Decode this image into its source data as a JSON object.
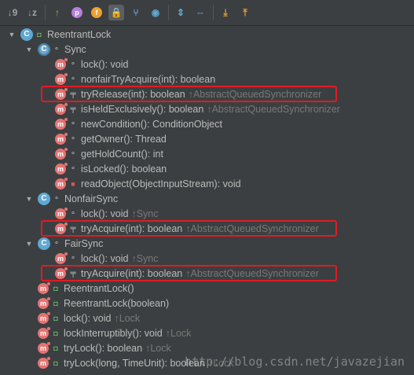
{
  "toolbar": {
    "buttons": [
      {
        "name": "sort-by-visibility-icon",
        "glyph": "↓",
        "sub": "9"
      },
      {
        "name": "sort-alphabetically-icon",
        "glyph": "↓",
        "sub": "z"
      },
      {
        "name": "show-inherited-icon",
        "glyph": "↑",
        "color": "#8bc34a"
      },
      {
        "name": "show-properties-icon",
        "glyph": "p",
        "color": "#b57edc"
      },
      {
        "name": "show-fields-icon",
        "glyph": "f",
        "color": "#f0a030"
      },
      {
        "name": "show-non-public-icon",
        "glyph": "🔒",
        "active": true,
        "color": "#e05252"
      },
      {
        "name": "show-lambdas-icon",
        "glyph": "⑂",
        "color": "#5fa8d3"
      },
      {
        "name": "show-anonymous-classes-icon",
        "glyph": "◉",
        "color": "#5fa8d3"
      },
      {
        "name": "expand-all-icon",
        "glyph": "⇕",
        "color": "#5fa8d3"
      },
      {
        "name": "collapse-all-icon",
        "glyph": "⇔",
        "color": "#5fa8d3"
      },
      {
        "name": "autoscroll-to-source-icon",
        "glyph": "⤓",
        "color": "#f0a030"
      },
      {
        "name": "autoscroll-from-source-icon",
        "glyph": "⤒",
        "color": "#f0a030"
      }
    ]
  },
  "tree": [
    {
      "indent": 0,
      "arrow": "▼",
      "kind": "class",
      "vis": "pub",
      "text": "ReentrantLock",
      "inh": ""
    },
    {
      "indent": 1,
      "arrow": "▼",
      "kind": "abs",
      "vis": "pkg",
      "text": "Sync",
      "inh": ""
    },
    {
      "indent": 2,
      "arrow": "",
      "kind": "m",
      "vis": "pkg",
      "text": "lock(): void",
      "inh": ""
    },
    {
      "indent": 2,
      "arrow": "",
      "kind": "m",
      "vis": "pkg",
      "text": "nonfairTryAcquire(int): boolean",
      "inh": ""
    },
    {
      "indent": 2,
      "arrow": "",
      "kind": "m",
      "vis": "prot",
      "text": "tryRelease(int): boolean",
      "inh": "↑AbstractQueuedSynchronizer",
      "hl": true
    },
    {
      "indent": 2,
      "arrow": "",
      "kind": "m",
      "vis": "prot",
      "text": "isHeldExclusively(): boolean",
      "inh": "↑AbstractQueuedSynchronizer"
    },
    {
      "indent": 2,
      "arrow": "",
      "kind": "m",
      "vis": "pkg",
      "text": "newCondition(): ConditionObject",
      "inh": ""
    },
    {
      "indent": 2,
      "arrow": "",
      "kind": "m",
      "vis": "pkg",
      "text": "getOwner(): Thread",
      "inh": ""
    },
    {
      "indent": 2,
      "arrow": "",
      "kind": "m",
      "vis": "pkg",
      "text": "getHoldCount(): int",
      "inh": ""
    },
    {
      "indent": 2,
      "arrow": "",
      "kind": "m",
      "vis": "pkg",
      "text": "isLocked(): boolean",
      "inh": ""
    },
    {
      "indent": 2,
      "arrow": "",
      "kind": "m",
      "vis": "priv",
      "text": "readObject(ObjectInputStream): void",
      "inh": ""
    },
    {
      "indent": 1,
      "arrow": "▼",
      "kind": "class",
      "vis": "pkg",
      "text": "NonfairSync",
      "inh": ""
    },
    {
      "indent": 2,
      "arrow": "",
      "kind": "m",
      "vis": "pkg",
      "text": "lock(): void",
      "inh": "↑Sync"
    },
    {
      "indent": 2,
      "arrow": "",
      "kind": "m",
      "vis": "prot",
      "text": "tryAcquire(int): boolean",
      "inh": "↑AbstractQueuedSynchronizer",
      "hl": true
    },
    {
      "indent": 1,
      "arrow": "▼",
      "kind": "class",
      "vis": "pkg",
      "text": "FairSync",
      "inh": ""
    },
    {
      "indent": 2,
      "arrow": "",
      "kind": "m",
      "vis": "pkg",
      "text": "lock(): void",
      "inh": "↑Sync"
    },
    {
      "indent": 2,
      "arrow": "",
      "kind": "m",
      "vis": "prot",
      "text": "tryAcquire(int): boolean",
      "inh": "↑AbstractQueuedSynchronizer",
      "hl": true
    },
    {
      "indent": 1,
      "arrow": "",
      "kind": "m",
      "vis": "pub",
      "text": "ReentrantLock()",
      "inh": ""
    },
    {
      "indent": 1,
      "arrow": "",
      "kind": "m",
      "vis": "pub",
      "text": "ReentrantLock(boolean)",
      "inh": ""
    },
    {
      "indent": 1,
      "arrow": "",
      "kind": "m",
      "vis": "pub",
      "text": "lock(): void",
      "inh": "↑Lock"
    },
    {
      "indent": 1,
      "arrow": "",
      "kind": "m",
      "vis": "pub",
      "text": "lockInterruptibly(): void",
      "inh": "↑Lock"
    },
    {
      "indent": 1,
      "arrow": "",
      "kind": "m",
      "vis": "pub",
      "text": "tryLock(): boolean",
      "inh": "↑Lock"
    },
    {
      "indent": 1,
      "arrow": "",
      "kind": "m",
      "vis": "pub",
      "text": "tryLock(long, TimeUnit): boolean",
      "inh": "↑Lock"
    }
  ],
  "watermark": "http://blog.csdn.net/javazejian"
}
